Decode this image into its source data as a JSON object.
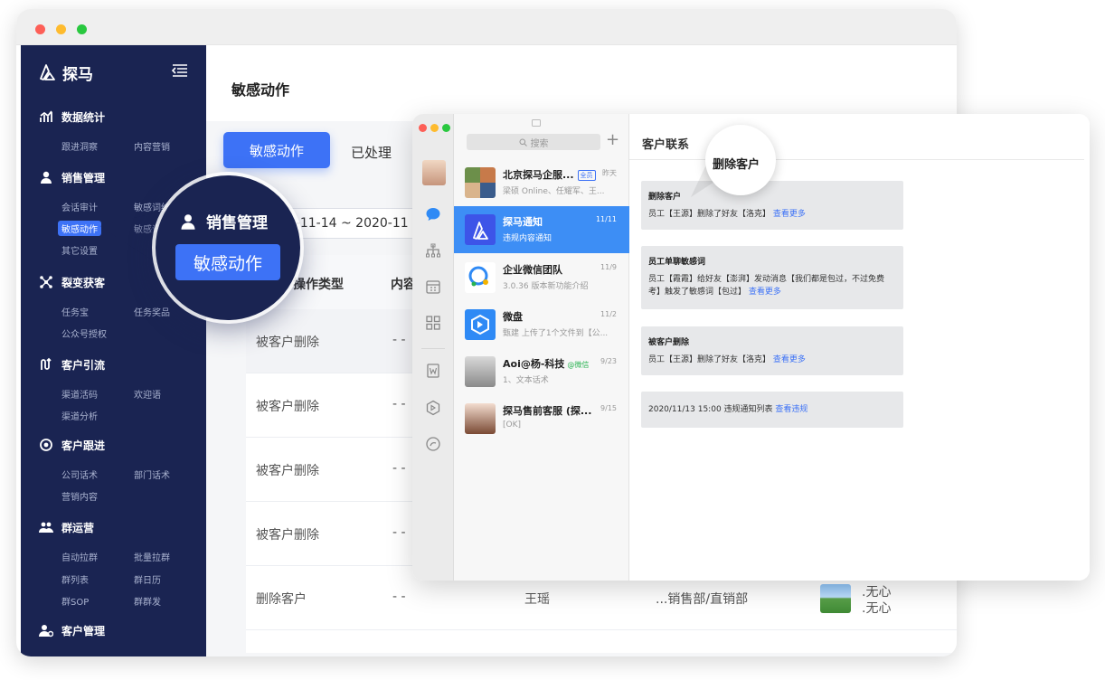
{
  "back_window": {
    "sidebar": {
      "logo_text": "探马",
      "sections": [
        {
          "title": "数据统计",
          "icon": "chart-icon",
          "items": [
            "跟进洞察",
            "内容营销"
          ]
        },
        {
          "title": "销售管理",
          "icon": "user-icon",
          "items": [
            "会话审计",
            "敏感词统",
            "敏感动作",
            "敏感词",
            "其它设置"
          ]
        },
        {
          "title": "裂变获客",
          "icon": "share-icon",
          "items": [
            "任务宝",
            "任务奖品",
            "公众号授权"
          ]
        },
        {
          "title": "客户引流",
          "icon": "flow-icon",
          "items": [
            "渠道活码",
            "欢迎语",
            "渠道分析"
          ]
        },
        {
          "title": "客户跟进",
          "icon": "target-icon",
          "items": [
            "公司话术",
            "部门话术",
            "营销内容"
          ]
        },
        {
          "title": "群运营",
          "icon": "group-icon",
          "items": [
            "自动拉群",
            "批量拉群",
            "群列表",
            "群日历",
            "群SOP",
            "群群发"
          ]
        },
        {
          "title": "客户管理",
          "icon": "customer-icon",
          "items": []
        }
      ],
      "active_item": "敏感动作"
    },
    "main": {
      "title": "敏感动作",
      "tabs": [
        "敏感动作",
        "已处理"
      ],
      "date_range": "20-11-14 ~ 2020-11",
      "table": {
        "headers": [
          "操作类型",
          "内容"
        ],
        "rows": [
          {
            "type": "被客户删除",
            "content": "- -"
          },
          {
            "type": "被客户删除",
            "content": "- -"
          },
          {
            "type": "被客户删除",
            "content": "- -"
          },
          {
            "type": "被客户删除",
            "content": "- -"
          },
          {
            "type": "删除客户",
            "content": "- -",
            "employee": "王瑶",
            "dept": "...销售部/直销部",
            "customer_a": ".无心",
            "customer_b": ".无心"
          }
        ]
      }
    },
    "magnifier": {
      "section": "销售管理",
      "button": "敏感动作"
    }
  },
  "front_window": {
    "search_placeholder": "搜索",
    "plus": "+",
    "conversations": [
      {
        "name": "北京探马企服...",
        "badge": "全员",
        "time": "昨天",
        "msg": "梁硕 Online、任耀军、王...",
        "selected": false
      },
      {
        "name": "探马通知",
        "time": "11/11",
        "msg": "违规内容通知",
        "selected": true
      },
      {
        "name": "企业微信团队",
        "time": "11/9",
        "msg": "3.0.36 版本新功能介绍",
        "selected": false
      },
      {
        "name": "微盘",
        "time": "11/2",
        "msg": "甄建 上传了1个文件到【公...",
        "selected": false
      },
      {
        "name": "Aoi@杨-科技",
        "tag": "@微信",
        "time": "9/23",
        "msg": "1、文本话术",
        "selected": false
      },
      {
        "name": "探马售前客服 (探...",
        "time": "9/15",
        "msg": "[OK]",
        "selected": false
      }
    ],
    "chat": {
      "title": "客户联系",
      "bubble": "删除客户",
      "cards": [
        {
          "title": "删除客户",
          "body": "员工【王源】删除了好友【洛克】",
          "link": "查看更多"
        },
        {
          "title": "员工单聊敏感词",
          "body": "员工【霞霞】给好友【澎湃】发动消息【我们都是包过，不过免费考】触发了敏感词【包过】",
          "link": "查看更多"
        },
        {
          "title": "被客户删除",
          "body": "员工【王源】删除了好友【洛克】",
          "link": "查看更多"
        },
        {
          "title": "",
          "body": "2020/11/13 15:00 违规通知列表",
          "link": "查看违规"
        }
      ]
    }
  },
  "colors": {
    "sidebar_bg": "#1a2452",
    "accent": "#3d72f6",
    "selected_conv": "#3d8ef5"
  }
}
